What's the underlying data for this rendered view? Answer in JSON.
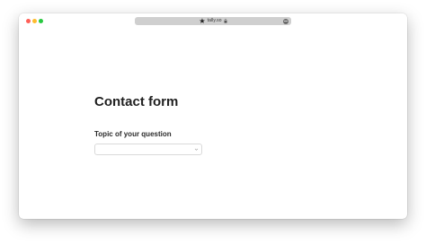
{
  "browser": {
    "url": "tally.so",
    "star_icon": "★",
    "lock_icon": "lock-icon",
    "more_icon": "more-icon"
  },
  "colors": {
    "close": "#ff5f57",
    "minimize": "#febc2e",
    "maximize": "#28c840",
    "address_bar": "#cfcfcf"
  },
  "form": {
    "title": "Contact form",
    "topic_label": "Topic of your question",
    "topic_value": ""
  }
}
